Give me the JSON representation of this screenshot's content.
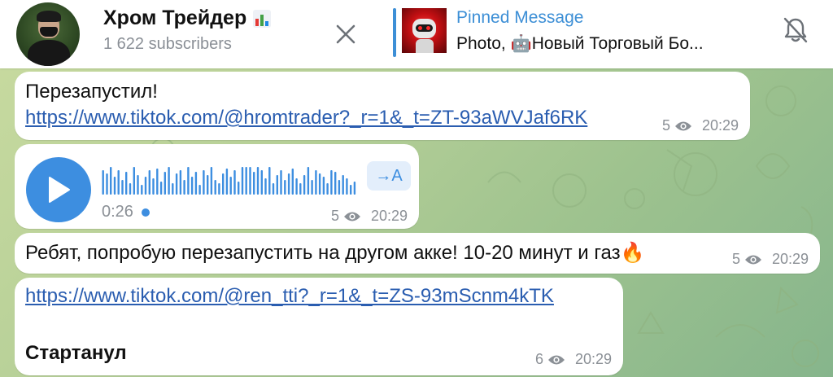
{
  "header": {
    "channel_title": "Хром Трейдер",
    "subscribers": "1 622 subscribers",
    "pinned": {
      "title": "Pinned Message",
      "text": "Photo, 🤖Новый Торговый Бо..."
    },
    "icons": {
      "close": "close-icon",
      "mute": "bell-off-icon",
      "channel_badge": "bar-chart-icon"
    }
  },
  "messages": [
    {
      "text": "Перезапустил!",
      "link": "https://www.tiktok.com/@hromtrader?_r=1&_t=ZT-93aWVJaf6RK",
      "views": "5",
      "time": "20:29"
    },
    {
      "type": "voice",
      "duration": "0:26",
      "transcribe_label": "→A",
      "views": "5",
      "time": "20:29"
    },
    {
      "text": "Ребят, попробую перезапустить на другом акке! 10-20 минут и газ🔥",
      "views": "5",
      "time": "20:29"
    },
    {
      "link": "https://www.tiktok.com/@ren_tti?_r=1&_t=ZS-93mScnm4kTK",
      "text": "Стартанул",
      "views": "6",
      "time": "20:29"
    }
  ],
  "colors": {
    "accent": "#3d8ee0",
    "link": "#2a5db0",
    "meta": "#8b9096",
    "background_green": "#b7d098"
  }
}
